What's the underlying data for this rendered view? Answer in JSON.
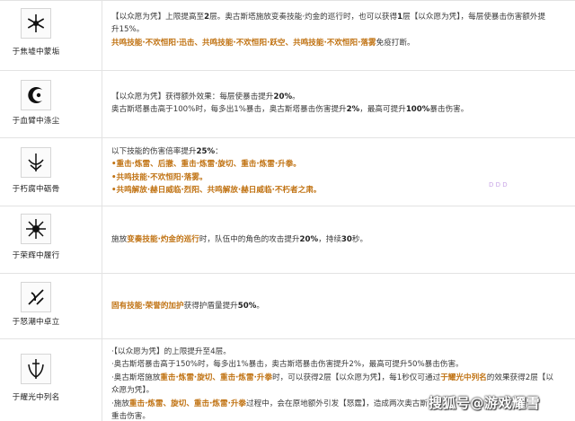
{
  "rows": [
    {
      "name": "于焦墟中蒙垢",
      "icon": "ice-crystal-icon",
      "lines": [
        [
          [
            "【以众愿为凭】上限提高至",
            ""
          ],
          [
            "2",
            "b"
          ],
          [
            "层。奥古斯塔施放变奏技能·灼金的巡行时，也可以获得",
            ""
          ],
          [
            "1",
            "b"
          ],
          [
            "层【以众愿为凭】，每层使暴击伤害额外提",
            ""
          ]
        ],
        [
          [
            "升15%。",
            ""
          ]
        ],
        [
          [
            "共鸣技能·不欢恒阳·迅击、共鸣技能·不欢恒阳·跃空、共鸣技能·不欢恒阳·落雾",
            "o"
          ],
          [
            "免疫打断。",
            ""
          ]
        ]
      ]
    },
    {
      "name": "于血臂中涤尘",
      "icon": "crescent-emblem-icon",
      "lines": [
        [
          [
            "【以众愿为凭】获得额外效果：每层使暴击提升",
            ""
          ],
          [
            "20%",
            "b"
          ],
          [
            "。",
            ""
          ]
        ],
        [
          [
            "奥古斯塔暴击高于100%时，每多出1%暴击，奥古斯塔暴击伤害提升",
            ""
          ],
          [
            "2%",
            "b"
          ],
          [
            "，最高可提升",
            ""
          ],
          [
            "100%",
            "b"
          ],
          [
            "暴击伤害。",
            ""
          ]
        ]
      ]
    },
    {
      "name": "于朽腐中砺骨",
      "icon": "sword-crest-icon",
      "lines": [
        [
          [
            "以下技能的伤害倍率提升",
            ""
          ],
          [
            "25%",
            "b"
          ],
          [
            "：",
            ""
          ]
        ],
        [
          [
            "•重击·炼雷、后撤、重击·炼雷·旋切、重击·炼雷·升拳。",
            "o"
          ]
        ],
        [
          [
            "•共鸣技能·不欢恒阳·落雾。",
            "o"
          ]
        ],
        [
          [
            "•共鸣解放·赫日威临·烈阳、共鸣解放·赫日威临·不朽者之肃。",
            "o"
          ]
        ]
      ]
    },
    {
      "name": "于荣辉中履行",
      "icon": "burst-star-icon",
      "lines": [
        [
          [
            "施放",
            ""
          ],
          [
            "变奏技能·灼金的巡行",
            "o"
          ],
          [
            "时，队伍中的角色的攻击提升",
            ""
          ],
          [
            "20%",
            "b"
          ],
          [
            "，持续",
            ""
          ],
          [
            "30",
            "b"
          ],
          [
            "秒。",
            ""
          ]
        ]
      ]
    },
    {
      "name": "于怒潮中卓立",
      "icon": "slash-blade-icon",
      "lines": [
        [
          [
            "固有技能·荣誉的加护",
            "o"
          ],
          [
            "获得护盾量提升",
            ""
          ],
          [
            "50%",
            "b"
          ],
          [
            "。",
            ""
          ]
        ]
      ]
    },
    {
      "name": "于耀光中列名",
      "icon": "sword-laurel-icon",
      "lines": [
        [
          [
            "·【以众愿为凭】的上限提升至4层。",
            ""
          ]
        ],
        [
          [
            "·奥古斯塔暴击高于150%时，每多出1%暴击，奥古斯塔暴击伤害提升2%，最高可提升50%暴击伤害。",
            ""
          ]
        ],
        [
          [
            "·奥古斯塔施放",
            ""
          ],
          [
            "重击·炼雷·旋切、重击·炼雷·升拳",
            "o"
          ],
          [
            "时，可以获得2层【以众愿为凭】，每1秒仅可通过",
            ""
          ],
          [
            "于耀光中列名",
            "o"
          ],
          [
            "的效果获得2层【以",
            ""
          ]
        ],
        [
          [
            "众愿为凭】。",
            ""
          ]
        ],
        [
          [
            "·施放",
            ""
          ],
          [
            "重击·炼雷、旋切、重击·炼雷·升拳",
            "o"
          ],
          [
            "过程中，会在原地额外引发【怒霆】，造成两次奥古斯",
            ""
          ]
        ],
        [
          [
            "重击伤害。",
            ""
          ]
        ]
      ]
    }
  ],
  "watermark": "搜狐号@游戏耀雪",
  "purple_mark": "ꓓ ꓓ ꓓ"
}
